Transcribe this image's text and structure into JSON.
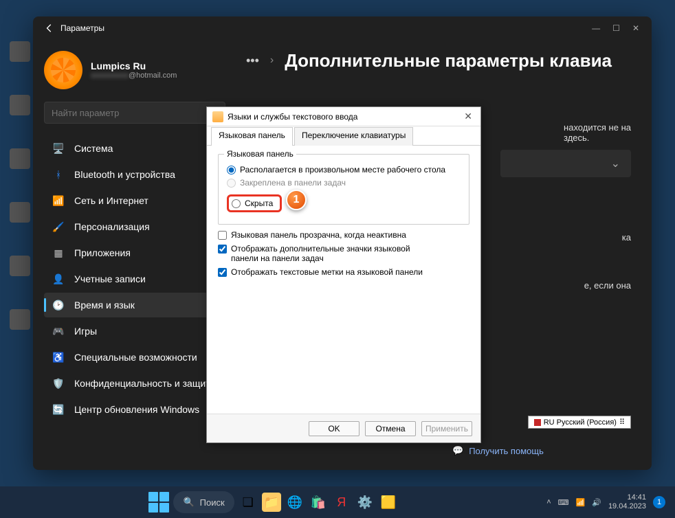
{
  "window": {
    "title": "Параметры"
  },
  "user": {
    "name": "Lumpics Ru",
    "email_suffix": "@hotmail.com"
  },
  "search_placeholder": "Найти параметр",
  "nav": [
    {
      "label": "Система"
    },
    {
      "label": "Bluetooth и устройства"
    },
    {
      "label": "Сеть и Интернет"
    },
    {
      "label": "Персонализация"
    },
    {
      "label": "Приложения"
    },
    {
      "label": "Учетные записи"
    },
    {
      "label": "Время и язык"
    },
    {
      "label": "Игры"
    },
    {
      "label": "Специальные возможности"
    },
    {
      "label": "Конфиденциальность и защит"
    },
    {
      "label": "Центр обновления Windows"
    }
  ],
  "active_nav_index": 6,
  "breadcrumb": {
    "dots": "•••",
    "title": "Дополнительные параметры клавиа"
  },
  "side_texts": {
    "t1a": "находится не на",
    "t1b": "здесь.",
    "t2": "ка",
    "t3": "е, если она"
  },
  "help_link": "Получить помощь",
  "dialog": {
    "title": "Языки и службы текстового ввода",
    "tab1": "Языковая панель",
    "tab2": "Переключение клавиатуры",
    "group_label": "Языковая панель",
    "radio1": "Располагается в произвольном месте рабочего стола",
    "radio2": "Закреплена в панели задач",
    "radio3": "Скрыта",
    "check1": "Языковая панель прозрачна, когда неактивна",
    "check2": "Отображать дополнительные значки языковой панели на панели задач",
    "check3": "Отображать текстовые метки на языковой панели",
    "btn_ok": "OK",
    "btn_cancel": "Отмена",
    "btn_apply": "Применить"
  },
  "marker": "1",
  "lang_badge": "RU Русский (Россия)",
  "taskbar": {
    "search": "Поиск"
  },
  "systray": {
    "time": "14:41",
    "date": "19.04.2023",
    "notif": "1"
  }
}
